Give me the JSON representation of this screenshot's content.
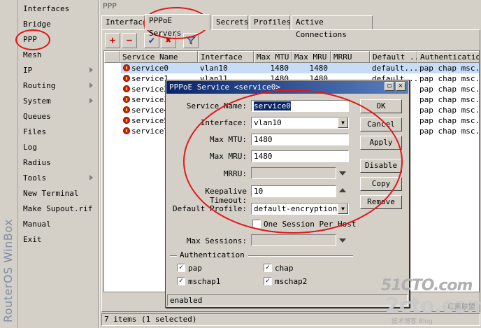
{
  "brand": "RouterOS WinBox",
  "sidebar": {
    "items": [
      {
        "label": "Interfaces",
        "has_submenu": false
      },
      {
        "label": "Bridge",
        "has_submenu": false
      },
      {
        "label": "PPP",
        "has_submenu": false
      },
      {
        "label": "Mesh",
        "has_submenu": false
      },
      {
        "label": "IP",
        "has_submenu": true
      },
      {
        "label": "Routing",
        "has_submenu": true
      },
      {
        "label": "System",
        "has_submenu": true
      },
      {
        "label": "Queues",
        "has_submenu": false
      },
      {
        "label": "Files",
        "has_submenu": false
      },
      {
        "label": "Log",
        "has_submenu": false
      },
      {
        "label": "Radius",
        "has_submenu": false
      },
      {
        "label": "Tools",
        "has_submenu": true
      },
      {
        "label": "New Terminal",
        "has_submenu": false
      },
      {
        "label": "Make Supout.rif",
        "has_submenu": false
      },
      {
        "label": "Manual",
        "has_submenu": false
      },
      {
        "label": "Exit",
        "has_submenu": false
      }
    ]
  },
  "ppp": {
    "title": "PPP",
    "tabs": [
      "Interface",
      "PPPoE Servers",
      "Secrets",
      "Profiles",
      "Active Connections"
    ],
    "active_tab": "PPPoE Servers",
    "toolbar": {
      "add": "+",
      "remove": "−",
      "enable": "✔",
      "disable": "✖",
      "filter": "filter-icon"
    },
    "columns": [
      "Service Name",
      "Interface",
      "Max MTU",
      "Max MRU",
      "MRRU",
      "Default ...",
      "Authentication"
    ],
    "rows": [
      {
        "name": "service0",
        "interface": "vlan10",
        "mtu": "1480",
        "mru": "1480",
        "mrru": "",
        "default": "default...",
        "auth": "pap chap msc..."
      },
      {
        "name": "service1",
        "interface": "vlan11",
        "mtu": "1480",
        "mru": "1480",
        "mrru": "",
        "default": "default...",
        "auth": "pap chap msc..."
      },
      {
        "name": "service2",
        "interface": "",
        "mtu": "",
        "mru": "",
        "mrru": "",
        "default": "",
        "auth": "pap chap msc..."
      },
      {
        "name": "service3",
        "interface": "",
        "mtu": "",
        "mru": "",
        "mrru": "",
        "default": "",
        "auth": "pap chap msc..."
      },
      {
        "name": "service4",
        "interface": "",
        "mtu": "",
        "mru": "",
        "mrru": "",
        "default": "",
        "auth": "pap chap msc..."
      },
      {
        "name": "service5",
        "interface": "",
        "mtu": "",
        "mru": "",
        "mrru": "",
        "default": "",
        "auth": "pap chap msc..."
      },
      {
        "name": "service7",
        "interface": "",
        "mtu": "",
        "mru": "",
        "mrru": "",
        "default": "",
        "auth": "pap chap msc..."
      }
    ],
    "status": "7 items (1 selected)"
  },
  "dialog": {
    "title": "PPPoE Service <service0>",
    "fields": {
      "service_name_label": "Service Name:",
      "service_name": "service0",
      "interface_label": "Interface:",
      "interface": "vlan10",
      "max_mtu_label": "Max MTU:",
      "max_mtu": "1480",
      "max_mru_label": "Max MRU:",
      "max_mru": "1480",
      "mrru_label": "MRRU:",
      "mrru": "",
      "keepalive_label": "Keepalive Timeout:",
      "keepalive": "10",
      "default_profile_label": "Default Profile:",
      "default_profile": "default-encryption",
      "one_session_label": "One Session Per Host",
      "max_sessions_label": "Max Sessions:",
      "max_sessions": ""
    },
    "auth_group": "Authentication",
    "auth": [
      {
        "label": "pap",
        "checked": true
      },
      {
        "label": "chap",
        "checked": true
      },
      {
        "label": "mschap1",
        "checked": true
      },
      {
        "label": "mschap2",
        "checked": true
      }
    ],
    "buttons": [
      "OK",
      "Cancel",
      "Apply",
      "Disable",
      "Copy",
      "Remove"
    ],
    "status": "enabled"
  },
  "watermark": {
    "line1": "51CTO.com",
    "line2": "2cto.com",
    "line3": "红黑联盟",
    "line4": "技术博客 Blog"
  },
  "colors": {
    "selection": "#c6dcf7",
    "title_bar": "#0a246a",
    "annotation": "#e01818"
  }
}
